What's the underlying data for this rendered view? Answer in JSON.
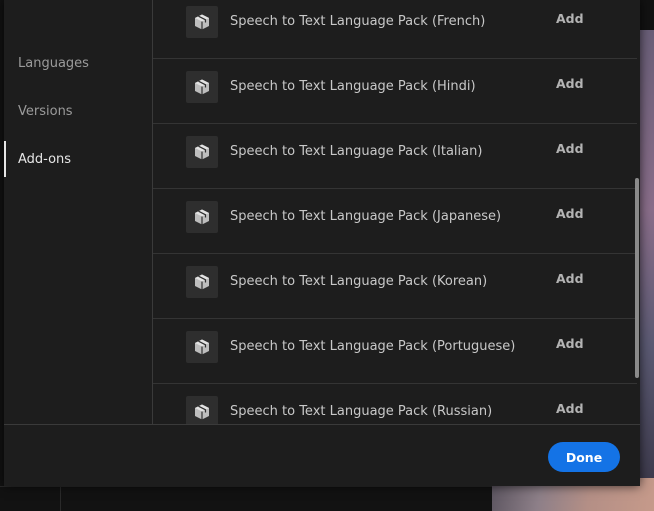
{
  "sidebar": {
    "items": [
      {
        "label": "Languages",
        "active": false
      },
      {
        "label": "Versions",
        "active": false
      },
      {
        "label": "Add-ons",
        "active": true
      }
    ]
  },
  "addons": {
    "icon": "package-cube-icon",
    "items": [
      {
        "label": "Speech to Text Language Pack (French)",
        "action": "Add"
      },
      {
        "label": "Speech to Text Language Pack (Hindi)",
        "action": "Add"
      },
      {
        "label": "Speech to Text Language Pack (Italian)",
        "action": "Add"
      },
      {
        "label": "Speech to Text Language Pack (Japanese)",
        "action": "Add"
      },
      {
        "label": "Speech to Text Language Pack (Korean)",
        "action": "Add"
      },
      {
        "label": "Speech to Text Language Pack (Portuguese)",
        "action": "Add"
      },
      {
        "label": "Speech to Text Language Pack (Russian)",
        "action": "Add"
      }
    ]
  },
  "footer": {
    "done_label": "Done"
  },
  "colors": {
    "accent": "#1473e6",
    "panel": "#1d1d1d",
    "text": "#c8c8c8"
  }
}
